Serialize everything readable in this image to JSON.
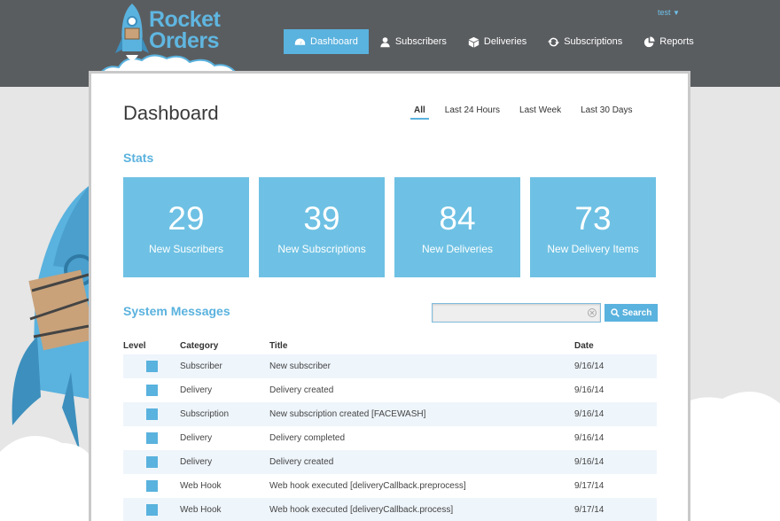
{
  "app": {
    "logo_line1": "Rocket",
    "logo_line2": "Orders",
    "user": "test",
    "accent_color": "#5ab2de"
  },
  "nav": [
    {
      "label": "Dashboard",
      "icon": "dashboard-icon",
      "active": true
    },
    {
      "label": "Subscribers",
      "icon": "user-icon"
    },
    {
      "label": "Deliveries",
      "icon": "box-icon"
    },
    {
      "label": "Subscriptions",
      "icon": "refresh-icon"
    },
    {
      "label": "Reports",
      "icon": "pie-chart-icon"
    }
  ],
  "page": {
    "title": "Dashboard",
    "filters": [
      "All",
      "Last 24 Hours",
      "Last Week",
      "Last 30 Days"
    ],
    "active_filter": "All"
  },
  "stats": {
    "title": "Stats",
    "items": [
      {
        "value": "29",
        "label": "New Suscribers"
      },
      {
        "value": "39",
        "label": "New Subscriptions"
      },
      {
        "value": "84",
        "label": "New Deliveries"
      },
      {
        "value": "73",
        "label": "New Delivery Items"
      }
    ]
  },
  "messages": {
    "title": "System Messages",
    "search_value": "",
    "search_label": "Search",
    "columns": [
      "Level",
      "Category",
      "Title",
      "Date"
    ],
    "rows": [
      {
        "category": "Subscriber",
        "title": "New subscriber",
        "date": "9/16/14"
      },
      {
        "category": "Delivery",
        "title": "Delivery created",
        "date": "9/16/14"
      },
      {
        "category": "Subscription",
        "title": "New subscription created [FACEWASH]",
        "date": "9/16/14"
      },
      {
        "category": "Delivery",
        "title": "Delivery completed",
        "date": "9/16/14"
      },
      {
        "category": "Delivery",
        "title": "Delivery created",
        "date": "9/16/14"
      },
      {
        "category": "Web Hook",
        "title": "Web hook executed [deliveryCallback.preprocess]",
        "date": "9/17/14"
      },
      {
        "category": "Web Hook",
        "title": "Web hook executed [deliveryCallback.process]",
        "date": "9/17/14"
      }
    ]
  }
}
